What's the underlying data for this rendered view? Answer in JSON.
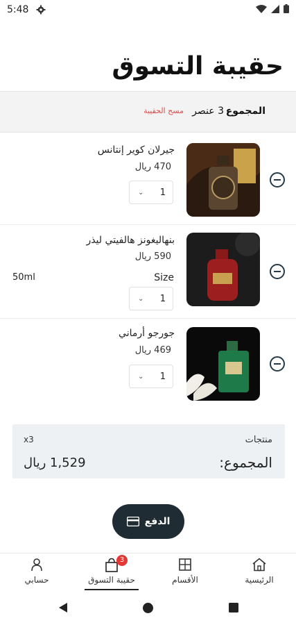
{
  "status_bar": {
    "time": "5:48"
  },
  "header": {
    "title": "حقيبة التسوق"
  },
  "summary": {
    "total_label": "المجموع",
    "count_text": "3 عنصر",
    "clear_label": "مسح الحقيبة"
  },
  "items": [
    {
      "name": "جيرلان كوير إنتانس",
      "price": "470 ريال",
      "qty": "1"
    },
    {
      "name": "بنهاليغونز هالفيتي ليذر",
      "price": "590 ريال",
      "qty": "1",
      "size_label": "Size",
      "size_value": "50ml"
    },
    {
      "name": "جورجو أرماني",
      "price": "469 ريال",
      "qty": "1"
    }
  ],
  "totals": {
    "products_label": "منتجات",
    "products_count": "x3",
    "total_label": "المجموع:",
    "total_value": "1,529 ريال"
  },
  "pay_button": {
    "label": "الدفع"
  },
  "bottom_nav": {
    "items": [
      {
        "label": "الرئيسية"
      },
      {
        "label": "الأقسام"
      },
      {
        "label": "حقيبة التسوق",
        "badge": "3"
      },
      {
        "label": "حسابي"
      }
    ]
  },
  "colors": {
    "accent": "#1f2c33",
    "danger": "#e24a4a",
    "badge": "#e53935"
  }
}
